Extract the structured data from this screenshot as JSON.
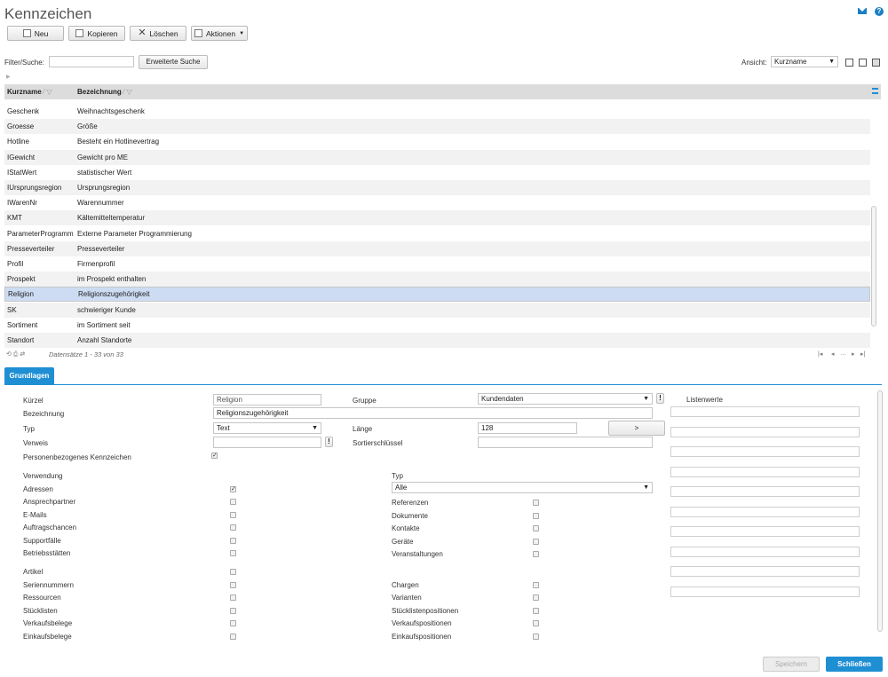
{
  "page": {
    "title": "Kennzeichen"
  },
  "toolbar": {
    "new_label": "Neu",
    "copy_label": "Kopieren",
    "delete_label": "Löschen",
    "actions_label": "Aktionen"
  },
  "filter": {
    "label": "Filter/Suche:",
    "value": "",
    "extended_search_label": "Erweiterte Suche",
    "view_label": "Ansicht:",
    "view_value": "Kurzname"
  },
  "grid": {
    "col_short": "Kurzname",
    "col_desc": "Bezeichnung",
    "rows": [
      [
        "Geschenk",
        "Weihnachtsgeschenk"
      ],
      [
        "Groesse",
        "Größe"
      ],
      [
        "Hotline",
        "Besteht ein Hotlinevertrag"
      ],
      [
        "IGewicht",
        "Gewicht pro ME"
      ],
      [
        "IStatWert",
        "statistischer Wert"
      ],
      [
        "IUrsprungsregion",
        "Ursprungsregion"
      ],
      [
        "IWarenNr",
        "Warennummer"
      ],
      [
        "KMT",
        "Kältemitteltemperatur"
      ],
      [
        "ParameterProgramm",
        "Externe Parameter Programmierung"
      ],
      [
        "Presseverteiler",
        "Presseverteiler"
      ],
      [
        "Profil",
        "Firmenprofil"
      ],
      [
        "Prospekt",
        "im Prospekt enthalten"
      ],
      [
        "Religion",
        "Religionszugehörigkeit"
      ],
      [
        "SK",
        "schwieriger Kunde"
      ],
      [
        "Sortiment",
        "im Sortiment seit"
      ],
      [
        "Standort",
        "Anzahl Standorte"
      ]
    ],
    "footer": "Datensätze 1 - 33 von 33"
  },
  "tab": {
    "label": "Grundlagen"
  },
  "form": {
    "kuerzel_label": "Kürzel",
    "kuerzel_value": "Religion",
    "gruppe_label": "Gruppe",
    "gruppe_value": "Kundendaten",
    "listenwerte_label": "Listenwerte",
    "bezeichnung_label": "Bezeichnung",
    "bezeichnung_value": "Religionszugehörigkeit",
    "typ_label": "Typ",
    "typ_value": "Text",
    "laenge_label": "Länge",
    "laenge_value": "128",
    "arrow_btn": ">",
    "verweis_label": "Verweis",
    "sort_label": "Sortierschlüssel",
    "personal_label": "Personenbezogenes Kennzeichen",
    "verwendung_label": "Verwendung",
    "typ2_label": "Typ",
    "typ2_value": "Alle",
    "excl": "!"
  },
  "usage_left": [
    {
      "label": "Adressen",
      "checked": true
    },
    {
      "label": "Ansprechpartner",
      "checked": false
    },
    {
      "label": "E-Mails",
      "checked": false
    },
    {
      "label": "Auftragschancen",
      "checked": false
    },
    {
      "label": "Supportfälle",
      "checked": false
    },
    {
      "label": "Betriebsstätten",
      "checked": false
    },
    {
      "label": "Artikel",
      "checked": false
    },
    {
      "label": "Seriennummern",
      "checked": false
    },
    {
      "label": "Ressourcen",
      "checked": false
    },
    {
      "label": "Stücklisten",
      "checked": false
    },
    {
      "label": "Verkaufsbelege",
      "checked": false
    },
    {
      "label": "Einkaufsbelege",
      "checked": false
    }
  ],
  "usage_right": [
    {
      "label": "Referenzen",
      "checked": false
    },
    {
      "label": "Dokumente",
      "checked": false
    },
    {
      "label": "Kontakte",
      "checked": false
    },
    {
      "label": "Geräte",
      "checked": false
    },
    {
      "label": "Veranstaltungen",
      "checked": false
    },
    {
      "label": "Chargen",
      "checked": false
    },
    {
      "label": "Varianten",
      "checked": false
    },
    {
      "label": "Stücklistenpositionen",
      "checked": false
    },
    {
      "label": "Verkaufspositionen",
      "checked": false
    },
    {
      "label": "Einkaufspositionen",
      "checked": false
    }
  ],
  "footer_buttons": {
    "save": "Speichern",
    "close": "Schließen"
  },
  "colors": {
    "accent": "#1f8fd3",
    "selected_row": "#cddcf2"
  }
}
